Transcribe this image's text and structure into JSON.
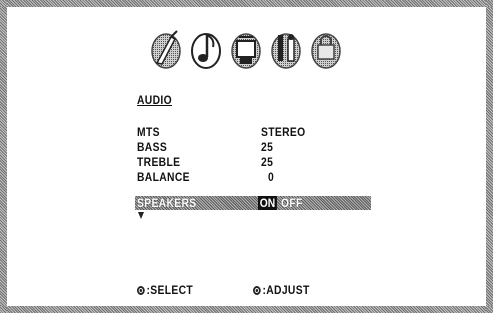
{
  "menu": {
    "title": "AUDIO",
    "icons": [
      "picture-brush-icon",
      "audio-note-icon",
      "channel-tv-icon",
      "tools-icon",
      "lock-icon"
    ],
    "items": [
      {
        "label": "MTS",
        "value": "STEREO"
      },
      {
        "label": "BASS",
        "value": "25"
      },
      {
        "label": "TREBLE",
        "value": "25"
      },
      {
        "label": "BALANCE",
        "value": "0"
      },
      {
        "label": "SPEAKERS",
        "on": "ON",
        "off": "OFF"
      }
    ],
    "more_indicator": "down-arrow-icon"
  },
  "footer": {
    "select": ":SELECT",
    "adjust": ":ADJUST"
  },
  "colors": {
    "highlight": "#9a9a9a",
    "text": "#111111",
    "border": "#8a8a8a"
  }
}
